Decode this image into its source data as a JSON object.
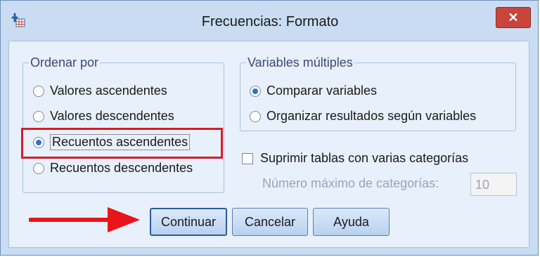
{
  "window": {
    "title": "Frecuencias: Formato",
    "close_label": "✕"
  },
  "order_group": {
    "legend": "Ordenar por",
    "options": [
      {
        "label": "Valores ascendentes",
        "checked": false
      },
      {
        "label": "Valores descendentes",
        "checked": false
      },
      {
        "label": "Recuentos ascendentes",
        "checked": true
      },
      {
        "label": "Recuentos descendentes",
        "checked": false
      }
    ]
  },
  "multi_group": {
    "legend": "Variables múltiples",
    "options": [
      {
        "label": "Comparar variables",
        "checked": true
      },
      {
        "label": "Organizar resultados según variables",
        "checked": false
      }
    ]
  },
  "suppress": {
    "label": "Suprimir tablas con varias categorías",
    "checked": false,
    "max_label": "Número máximo de categorías:",
    "max_value": "10"
  },
  "buttons": {
    "continue": "Continuar",
    "cancel": "Cancelar",
    "help": "Ayuda"
  },
  "colors": {
    "highlight": "#d0202a",
    "arrow": "#e8161b",
    "accent": "#2d73c9"
  }
}
